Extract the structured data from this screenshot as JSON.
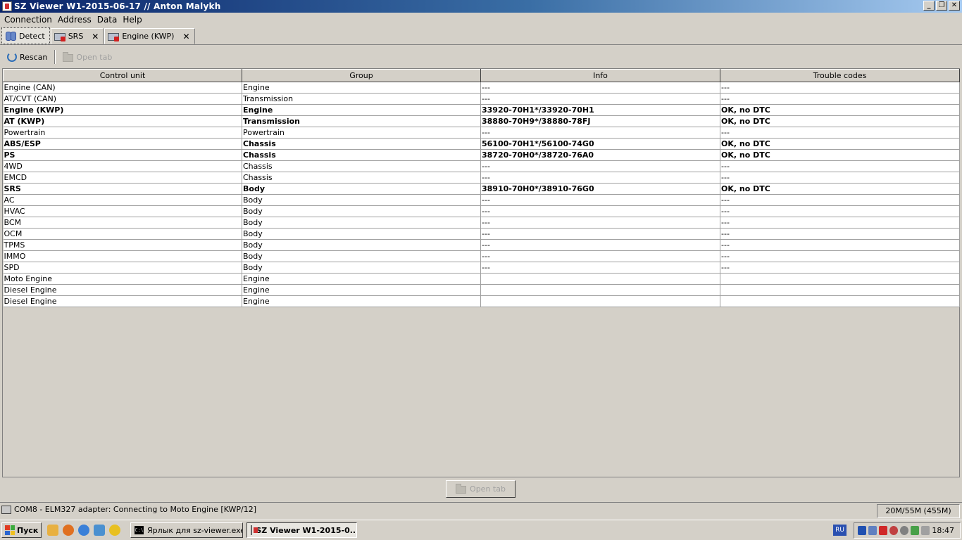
{
  "window": {
    "title": "SZ Viewer W1-2015-06-17 // Anton Malykh",
    "controls": [
      "_",
      "❐",
      "✕"
    ]
  },
  "menu": [
    "Connection",
    "Address",
    "Data",
    "Help"
  ],
  "tabs": [
    {
      "label": "Detect",
      "closable": false,
      "active": true
    },
    {
      "label": "SRS",
      "closable": true,
      "active": false
    },
    {
      "label": "Engine (KWP)",
      "closable": true,
      "active": false
    }
  ],
  "tab_close_glyph": "✕",
  "toolbar": {
    "rescan_label": "Rescan",
    "open_tab_label": "Open tab"
  },
  "table": {
    "columns": [
      "Control unit",
      "Group",
      "Info",
      "Trouble codes"
    ],
    "rows": [
      {
        "unit": "Engine (CAN)",
        "group": "Engine",
        "info": "---",
        "codes": "---",
        "bold": false
      },
      {
        "unit": "AT/CVT (CAN)",
        "group": "Transmission",
        "info": "---",
        "codes": "---",
        "bold": false
      },
      {
        "unit": "Engine (KWP)",
        "group": "Engine",
        "info": "33920-70H1*/33920-70H1",
        "codes": "OK, no DTC",
        "bold": true
      },
      {
        "unit": "AT (KWP)",
        "group": "Transmission",
        "info": "38880-70H9*/38880-78FJ",
        "codes": "OK, no DTC",
        "bold": true
      },
      {
        "unit": "Powertrain",
        "group": "Powertrain",
        "info": "---",
        "codes": "---",
        "bold": false
      },
      {
        "unit": "ABS/ESP",
        "group": "Chassis",
        "info": "56100-70H1*/56100-74G0",
        "codes": "OK, no DTC",
        "bold": true
      },
      {
        "unit": "PS",
        "group": "Chassis",
        "info": "38720-70H0*/38720-76A0",
        "codes": "OK, no DTC",
        "bold": true
      },
      {
        "unit": "4WD",
        "group": "Chassis",
        "info": "---",
        "codes": "---",
        "bold": false
      },
      {
        "unit": "EMCD",
        "group": "Chassis",
        "info": "---",
        "codes": "---",
        "bold": false
      },
      {
        "unit": "SRS",
        "group": "Body",
        "info": "38910-70H0*/38910-76G0",
        "codes": "OK, no DTC",
        "bold": true
      },
      {
        "unit": "AC",
        "group": "Body",
        "info": "---",
        "codes": "---",
        "bold": false
      },
      {
        "unit": "HVAC",
        "group": "Body",
        "info": "---",
        "codes": "---",
        "bold": false
      },
      {
        "unit": "BCM",
        "group": "Body",
        "info": "---",
        "codes": "---",
        "bold": false
      },
      {
        "unit": "OCM",
        "group": "Body",
        "info": "---",
        "codes": "---",
        "bold": false
      },
      {
        "unit": "TPMS",
        "group": "Body",
        "info": "---",
        "codes": "---",
        "bold": false
      },
      {
        "unit": "IMMO",
        "group": "Body",
        "info": "---",
        "codes": "---",
        "bold": false
      },
      {
        "unit": "SPD",
        "group": "Body",
        "info": "---",
        "codes": "---",
        "bold": false
      },
      {
        "unit": "Moto Engine",
        "group": "Engine",
        "info": "",
        "codes": "",
        "bold": false
      },
      {
        "unit": "Diesel Engine",
        "group": "Engine",
        "info": "",
        "codes": "",
        "bold": false
      },
      {
        "unit": "Diesel Engine",
        "group": "Engine",
        "info": "",
        "codes": "",
        "bold": false
      }
    ]
  },
  "bottom_button": {
    "label": "Open tab"
  },
  "status": {
    "text": "COM8 - ELM327 adapter: Connecting to Moto Engine [KWP/12]",
    "memory": "20M/55M (455M)"
  },
  "taskbar": {
    "start_label": "Пуск",
    "tasks": [
      {
        "label": "Ярлык для sz-viewer.exe",
        "active": false
      },
      {
        "label": "SZ Viewer W1-2015-0...",
        "active": true
      }
    ],
    "language": "RU",
    "clock": "18:47"
  }
}
